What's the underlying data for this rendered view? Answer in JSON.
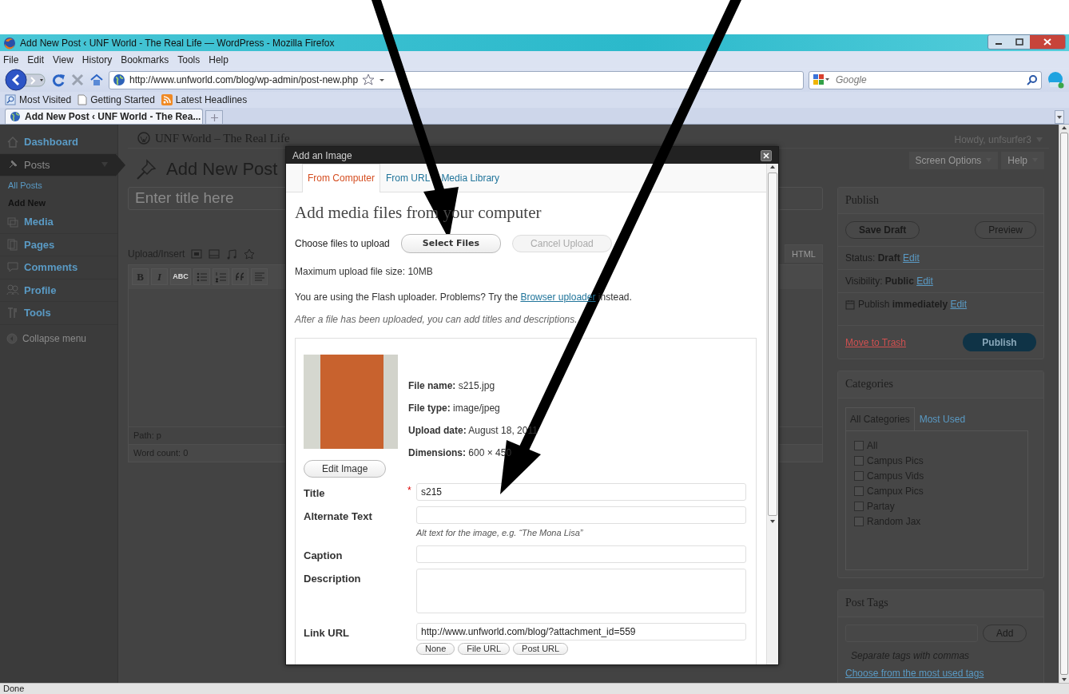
{
  "window": {
    "title": "Add New Post ‹ UNF World - The Real Life — WordPress - Mozilla Firefox"
  },
  "menu": [
    "File",
    "Edit",
    "View",
    "History",
    "Bookmarks",
    "Tools",
    "Help"
  ],
  "address": {
    "url": "http://www.unfworld.com/blog/wp-admin/post-new.php"
  },
  "search": {
    "placeholder": "Google"
  },
  "bookmarks": [
    "Most Visited",
    "Getting Started",
    "Latest Headlines"
  ],
  "tabs": [
    {
      "label": "Add New Post ‹ UNF World - The Rea...",
      "selected": true
    }
  ],
  "site_title": "UNF World – The Real Life",
  "howdy": "Howdy, unfsurfer3",
  "screen_buttons": [
    "Screen Options",
    "Help"
  ],
  "admin_menu": [
    {
      "label": "Dashboard",
      "selected": false
    },
    {
      "label": "Posts",
      "selected": true,
      "children": [
        {
          "label": "All Posts",
          "selected": false
        },
        {
          "label": "Add New",
          "selected": true
        }
      ]
    },
    {
      "label": "Media",
      "selected": false
    },
    {
      "label": "Pages",
      "selected": false
    },
    {
      "label": "Comments",
      "selected": false
    },
    {
      "label": "Profile",
      "selected": false
    },
    {
      "label": "Tools",
      "selected": false
    }
  ],
  "collapse_menu": "Collapse menu",
  "page_title": "Add New Post",
  "title_field": {
    "placeholder": "Enter title here"
  },
  "editor": {
    "upload_label": "Upload/Insert",
    "format_buttons": [
      "B",
      "I",
      "ABC"
    ],
    "html_tab": "HTML",
    "path": "Path: p",
    "word_count": "Word count: 0"
  },
  "publish": {
    "title": "Publish",
    "save_draft": "Save Draft",
    "preview": "Preview",
    "lines": [
      {
        "text": "Status: **Draft**",
        "link": "Edit"
      },
      {
        "text": "Visibility: **Public**",
        "link": "Edit"
      },
      {
        "text": "Publish **immediately**",
        "link": "Edit"
      }
    ],
    "trash": "Move to Trash",
    "publish_button": "Publish"
  },
  "categories": {
    "title": "Categories",
    "tabs": [
      {
        "label": "All Categories",
        "selected": true
      },
      {
        "label": "Most Used",
        "selected": false
      }
    ],
    "items": [
      {
        "label": "All",
        "checked": false
      },
      {
        "label": "Campus Pics",
        "checked": false
      },
      {
        "label": "Campus Vids",
        "checked": false
      },
      {
        "label": "Campux Pics",
        "checked": false
      },
      {
        "label": "Partay",
        "checked": false
      },
      {
        "label": "Random Jax",
        "checked": false
      }
    ]
  },
  "post_tags": {
    "title": "Post Tags",
    "add": "Add",
    "hint": "Separate tags with commas",
    "link": "Choose from the most used tags"
  },
  "dialog": {
    "title": "Add an Image",
    "tabs": [
      {
        "label": "From Computer",
        "selected": true
      },
      {
        "label": "From URL",
        "selected": false
      },
      {
        "label": "Media Library",
        "selected": false
      }
    ],
    "heading": "Add media files from your computer",
    "choose_label": "Choose files to upload",
    "select_button": "Select Files",
    "cancel_button": {
      "label": "Cancel Upload",
      "disabled": true
    },
    "max_size": "Maximum upload file size: 10MB",
    "flash_text": "You are using the Flash uploader. Problems? Try the",
    "flash_link": "Browser uploader",
    "flash_after": "instead.",
    "after_note": "After a file has been uploaded, you can add titles and descriptions.",
    "details": [
      "**File name:** s215.jpg",
      "**File type:** image/jpeg",
      "**Upload date:** August 18, 2011",
      "**Dimensions:** 600 × 450"
    ],
    "edit_image": "Edit Image",
    "fields": [
      {
        "label": "Title",
        "required": true,
        "kind": "input",
        "value": "s215"
      },
      {
        "label": "Alternate Text",
        "required": false,
        "kind": "input",
        "help": "Alt text for the image, e.g. “The Mona Lisa”"
      },
      {
        "label": "Caption",
        "required": false,
        "kind": "input"
      },
      {
        "label": "Description",
        "required": false,
        "kind": "textarea"
      },
      {
        "label": "Link URL",
        "required": false,
        "kind": "input",
        "value": "http://www.unfworld.com/blog/?attachment_id=559"
      }
    ],
    "required_mark": "*",
    "link_buttons": [
      "None",
      "File URL",
      "Post URL"
    ]
  },
  "status_bar": "Done"
}
